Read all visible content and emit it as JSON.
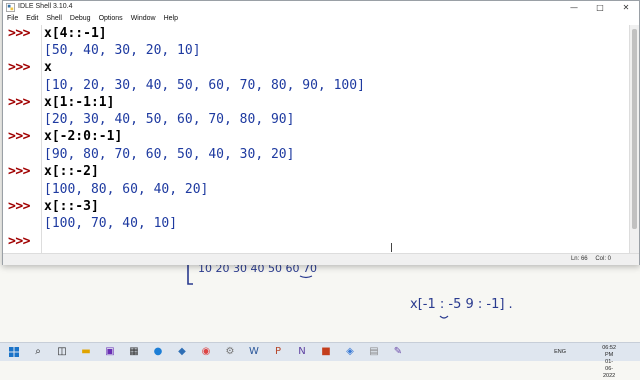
{
  "window": {
    "title": "IDLE Shell 3.10.4",
    "menus": [
      "File",
      "Edit",
      "Shell",
      "Debug",
      "Options",
      "Window",
      "Help"
    ],
    "controls": [
      "—",
      "□",
      "✕"
    ]
  },
  "shell": {
    "prompt": ">>>",
    "lines": [
      {
        "kind": "cmd",
        "text": "x[4::-1]"
      },
      {
        "kind": "out",
        "text": "[50, 40, 30, 20, 10]"
      },
      {
        "kind": "cmd",
        "text": "x"
      },
      {
        "kind": "out",
        "text": "[10, 20, 30, 40, 50, 60, 70, 80, 90, 100]"
      },
      {
        "kind": "cmd",
        "text": "x[1:-1:1]"
      },
      {
        "kind": "out",
        "text": "[20, 30, 40, 50, 60, 70, 80, 90]"
      },
      {
        "kind": "cmd",
        "text": "x[-2:0:-1]"
      },
      {
        "kind": "out",
        "text": "[90, 80, 70, 60, 50, 40, 30, 20]"
      },
      {
        "kind": "cmd",
        "text": "x[::-2]"
      },
      {
        "kind": "out",
        "text": "[100, 80, 60, 40, 20]"
      },
      {
        "kind": "cmd",
        "text": "x[::-3]"
      },
      {
        "kind": "out",
        "text": "[100, 70, 40, 10]"
      },
      {
        "kind": "cmd",
        "text": ""
      }
    ]
  },
  "status": {
    "line": "Ln: 66",
    "col": "Col: 0"
  },
  "whiteboard": {
    "row_text": "10   20  30   40   50   60   70",
    "expression": "x[-1 : -5 9 : -1] ."
  },
  "taskbar": {
    "language": "ENG",
    "time": "06:52 PM",
    "date": "01-06-2022"
  },
  "colors": {
    "prompt": "#a00000",
    "output": "#1e3aa0",
    "ink": "#2a3b8f"
  }
}
